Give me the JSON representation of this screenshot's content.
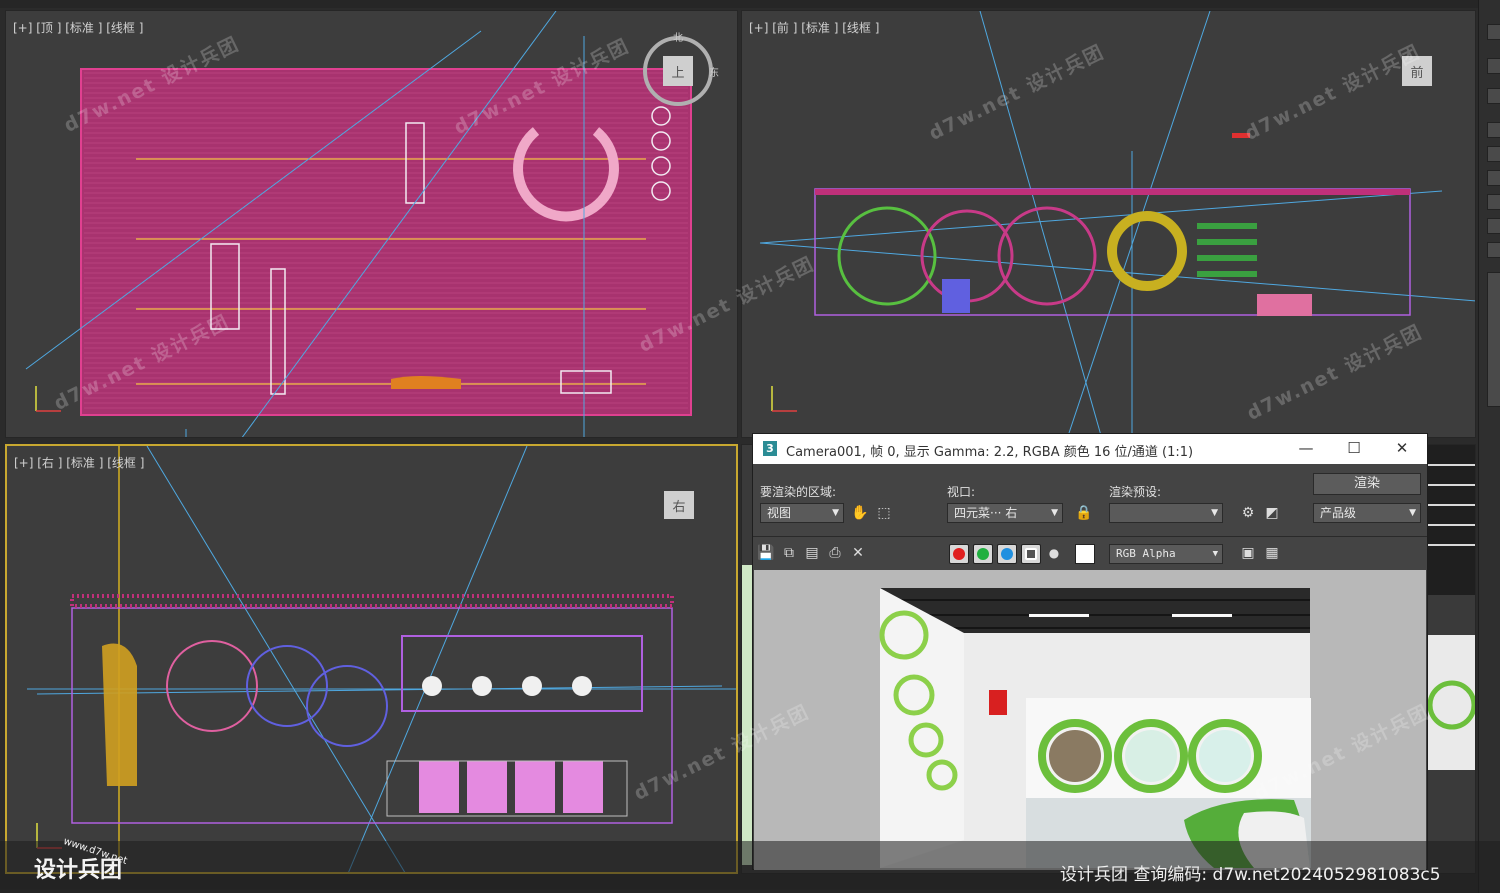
{
  "viewports": {
    "top": {
      "label": "[+] [顶 ] [标准 ] [线框 ]",
      "nav_north": "北",
      "nav_east": "东",
      "nav_face": "上"
    },
    "front": {
      "label": "[+] [前 ] [标准 ] [线框 ]",
      "nav_face": "前"
    },
    "right": {
      "label": "[+] [右 ] [标准 ] [线框 ]",
      "nav_face": "右"
    }
  },
  "render_window": {
    "title": "Camera001, 帧 0, 显示 Gamma: 2.2, RGBA 颜色 16 位/通道 (1:1)",
    "area_label": "要渲染的区域:",
    "area_value": "视图",
    "viewport_label": "视口:",
    "viewport_value": "四元菜··· 右",
    "preset_label": "渲染预设:",
    "preset_value": "",
    "render_button": "渲染",
    "quality_value": "产品级",
    "channel_value": "RGB Alpha"
  },
  "watermark_text": "d7w.net 设计兵团",
  "logo": {
    "name": "设计兵团",
    "url": "www.d7w.net"
  },
  "bottom_caption": "设计兵团  查询编码: d7w.net2024052981083c5",
  "colors": {
    "viewport_bg": "#3d3d3d",
    "active_border": "#c8a830",
    "wire_magenta": "#c0307a",
    "wire_blue": "#4fa8e0"
  }
}
